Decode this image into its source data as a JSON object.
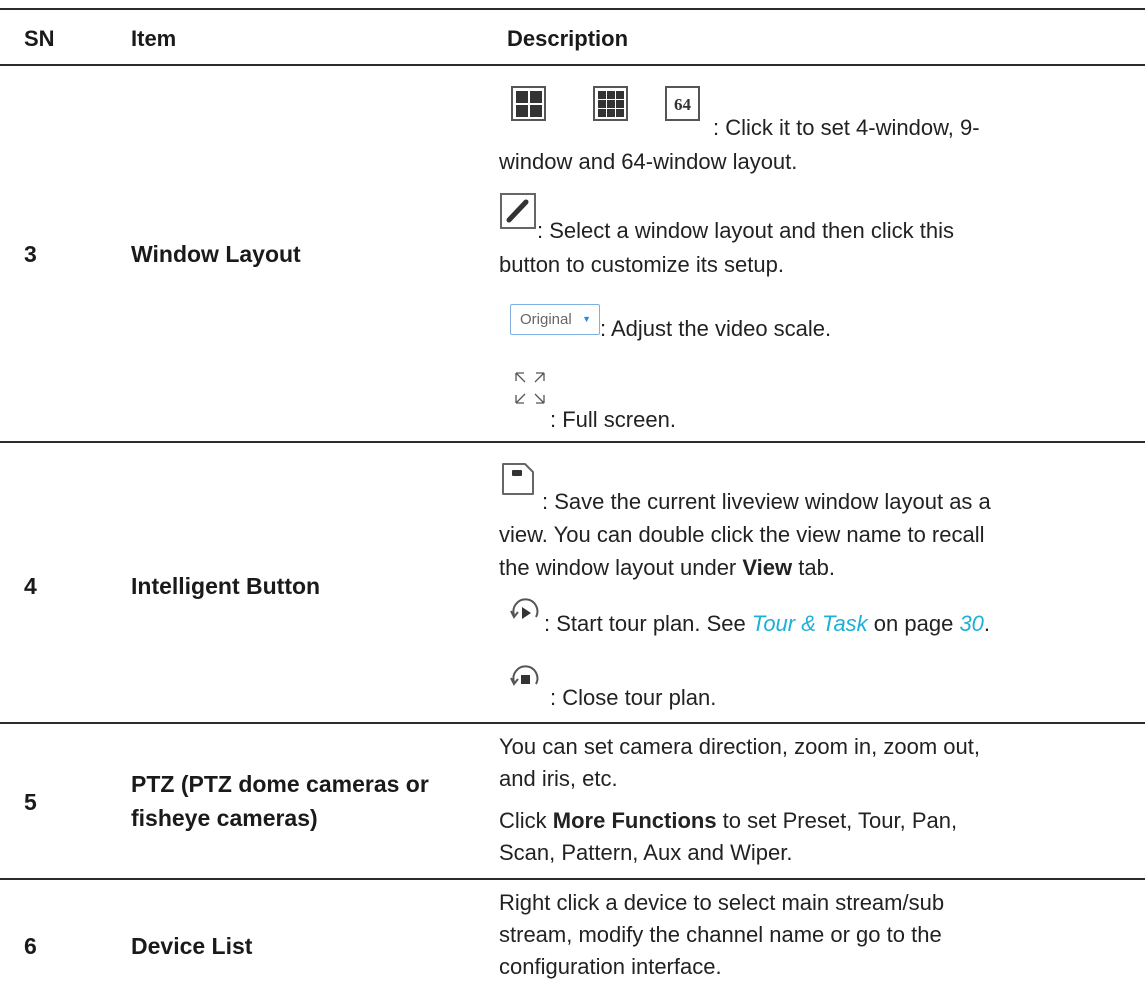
{
  "table": {
    "headers": [
      "SN",
      "Item",
      "Description"
    ],
    "rows": [
      {
        "sn": "3",
        "item": "Window Layout",
        "lines": [
          {
            "icon": "window-layout-icons",
            "text": ": Click it to set 4-window, 9-",
            "text2": "window and 64-window layout.",
            "icon_label": "64"
          },
          {
            "icon": "pencil-icon",
            "text": ": Select a window layout and then click this",
            "text2": "button to customize its setup."
          },
          {
            "icon": "scale-dropdown",
            "dropdown_value": "Original",
            "text": ": Adjust the video scale."
          },
          {
            "icon": "fullscreen-icon",
            "text": ": Full screen."
          }
        ]
      },
      {
        "sn": "4",
        "item": "Intelligent Button",
        "lines": [
          {
            "icon": "save-view-icon",
            "text": ": Save the current liveview window layout as a",
            "text2": "view. You can double click the view name to recall",
            "text3_pre": "the window layout under ",
            "text3_bold": "View",
            "text3_post": " tab."
          },
          {
            "icon": "start-tour-icon",
            "text_pre": ": Start tour plan. See ",
            "link1": "Tour & Task",
            "text_mid": " on page ",
            "link2": "30",
            "text_post": "."
          },
          {
            "icon": "close-tour-icon",
            "text": ": Close tour plan."
          }
        ]
      },
      {
        "sn": "5",
        "item": "PTZ (PTZ dome cameras or fisheye cameras)",
        "item_line1": "PTZ (PTZ dome cameras or",
        "item_line2": "fisheye cameras)",
        "p1_l1": "You can set camera direction, zoom in, zoom out,",
        "p1_l2": "and iris, etc.",
        "p2_pre": "Click ",
        "p2_bold": "More Functions",
        "p2_post": " to set Preset, Tour, Pan,",
        "p2_l2": "Scan, Pattern, Aux and Wiper."
      },
      {
        "sn": "6",
        "item": "Device List",
        "l1": "Right click a device to select main stream/sub",
        "l2": "stream, modify the channel name or go to the",
        "l3": "configuration interface."
      }
    ]
  },
  "colors": {
    "rule": "#2b2b2b",
    "link": "#1ab0d8",
    "dropdown_arrow": "#2a8be0"
  }
}
